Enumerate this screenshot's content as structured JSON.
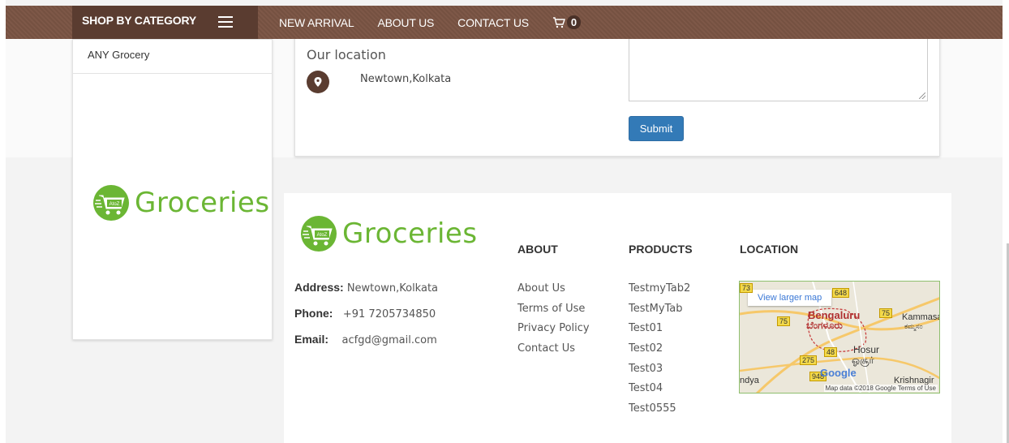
{
  "nav": {
    "shop_by_category": "SHOP BY CATEGORY",
    "links": [
      "NEW ARRIVAL",
      "ABOUT US",
      "CONTACT US"
    ],
    "cart_count": "0"
  },
  "sidebar": {
    "items": [
      "ANY Grocery"
    ]
  },
  "logo": {
    "badge": "AtoZ",
    "text": "Groceries",
    "color": "#6bb634"
  },
  "contact": {
    "heading": "Our location",
    "location": "Newtown,Kolkata",
    "submit_label": "Submit"
  },
  "footer": {
    "address_label": "Address:",
    "address_value": "Newtown,Kolkata",
    "phone_label": "Phone:",
    "phone_value": "+91 7205734850",
    "email_label": "Email:",
    "email_value": "acfgd@gmail.com",
    "about": {
      "heading": "ABOUT",
      "items": [
        "About Us",
        "Terms of Use",
        "Privacy Policy",
        "Contact Us"
      ]
    },
    "products": {
      "heading": "PRODUCTS",
      "items": [
        "TestmyTab2",
        "TestMyTab",
        "Test01",
        "Test02",
        "Test03",
        "Test04",
        "Test0555"
      ]
    },
    "location": {
      "heading": "LOCATION"
    }
  },
  "map": {
    "view_larger": "View larger map",
    "city": "Bengaluru",
    "city_local": "ಬೆಂಗಳೂರು",
    "hosur": "Hosur",
    "hosur_local": "ஓசூர்",
    "kammasandra": "Kammasa",
    "kammasandra_local": "ಕಮ್ಮಸಂ",
    "krishnagiri": "Krishnagir",
    "andya": "ndya",
    "road_badges": [
      "73",
      "648",
      "75",
      "75",
      "48",
      "275",
      "948"
    ],
    "google": "Google",
    "credit": "Map data ©2018 Google  Terms of Use"
  },
  "colors": {
    "nav_bg": "#7b5544",
    "nav_dark": "#5a3c30",
    "submit_bg": "#337ab7",
    "brand_green": "#6bb634"
  }
}
